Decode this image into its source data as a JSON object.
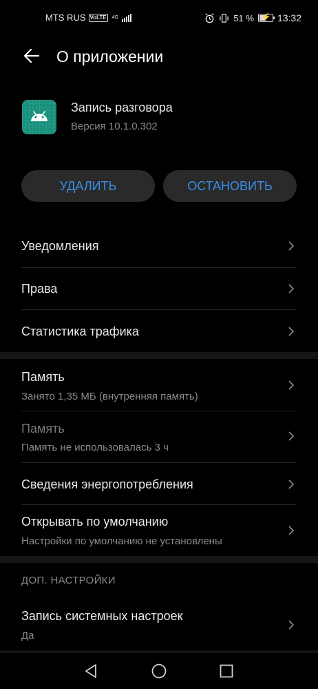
{
  "status_bar": {
    "carrier": "MTS RUS",
    "volte": "VoLTE",
    "network": "4G",
    "battery_percent": "51 %",
    "battery_level": 0.51,
    "time": "13:32"
  },
  "header": {
    "title": "О приложении"
  },
  "app": {
    "name": "Запись разговора",
    "version": "Версия 10.1.0.302",
    "icon_color": "#1a8f7c"
  },
  "actions": {
    "uninstall": "УДАЛИТЬ",
    "force_stop": "ОСТАНОВИТЬ",
    "accent": "#3b8ee8"
  },
  "items": [
    {
      "label": "Уведомления"
    },
    {
      "label": "Права"
    },
    {
      "label": "Статистика трафика"
    },
    {
      "label": "Память",
      "sub": "Занято 1,35 МБ (внутренняя память)"
    },
    {
      "label": "Память",
      "sub": "Память не использовалась 3 ч"
    },
    {
      "label": "Сведения энергопотребления"
    },
    {
      "label": "Открывать по умолчанию",
      "sub": "Настройки по умолчанию не установлены"
    }
  ],
  "advanced": {
    "section_title": "ДОП. НАСТРОЙКИ",
    "items": [
      {
        "label": "Запись системных настроек",
        "sub": "Да"
      }
    ]
  }
}
